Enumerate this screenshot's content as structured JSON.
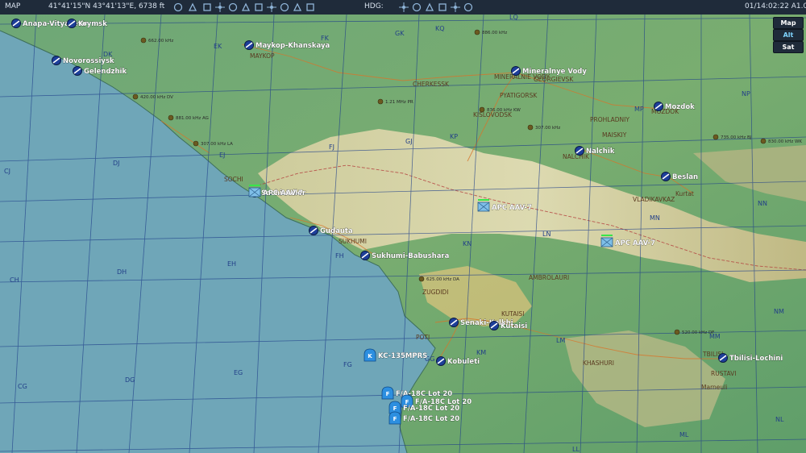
{
  "topbar": {
    "app_label": "MAP",
    "coords": "41°41'15\"N 43°41'13\"E, 6738 ft",
    "hdg_label": "HDG:",
    "clock": "01/14:02:22 A1.00",
    "icons": [
      "navigate-icon",
      "label-icon",
      "circle-icon",
      "grid-icon",
      "eye-icon",
      "dots-icon",
      "target-icon",
      "radio-icon",
      "tower-icon",
      "compass-icon",
      "move-icon",
      "zoom-in-icon",
      "zoom-out-icon",
      "zoom-fit-icon",
      "zoom-area-icon",
      "copy-icon",
      "layers-icon"
    ]
  },
  "map_modes": [
    "Map",
    "Alt",
    "Sat"
  ],
  "active_mode": "Alt",
  "colors": {
    "sea": "#6fa6b8",
    "topbar": "#1f2b3a",
    "grid": "#1f3f8a",
    "airbase": "#1e3f9a",
    "friendly_aircraft": "#2d8fe0",
    "label": "#ffffff"
  },
  "grid_labels": [
    "LQ",
    "KQ",
    "GK",
    "FK",
    "EK",
    "DK",
    "KP",
    "GJ",
    "FJ",
    "EJ",
    "DJ",
    "CJ",
    "MP",
    "NP",
    "NN",
    "MN",
    "LN",
    "KN",
    "FH",
    "EH",
    "DH",
    "CH",
    "NM",
    "MM",
    "LM",
    "KM",
    "GG",
    "FG",
    "EG",
    "DG",
    "CG",
    "NL",
    "ML",
    "LL"
  ],
  "place_labels": [
    "CHERKESSK",
    "MINERALNIE VODY",
    "GEORGIEVSK",
    "PYATIGORSK",
    "KISLOVODSK",
    "PROHLADNIY",
    "MAISKIY",
    "NALCHIK",
    "MOZDOK",
    "VLADIKAVKAZ",
    "Kurtat",
    "SOCHI",
    "SUKHUMI",
    "AMBROLAURI",
    "ZUGDIDI",
    "KUTAISI",
    "POTI",
    "KHASHURI",
    "TBILISI",
    "RUSTAVI",
    "Marneuli",
    "MAYKOP"
  ],
  "airbases": [
    {
      "name": "Anapa-Vityazevo"
    },
    {
      "name": "Krymsk"
    },
    {
      "name": "Novorossiysk"
    },
    {
      "name": "Gelendzhik"
    },
    {
      "name": "Maykop-Khanskaya"
    },
    {
      "name": "Mineralnye Vody"
    },
    {
      "name": "Mozdok"
    },
    {
      "name": "Nalchik"
    },
    {
      "name": "Beslan"
    },
    {
      "name": "Sochi-Adler"
    },
    {
      "name": "Gudauta"
    },
    {
      "name": "Sukhumi-Babushara"
    },
    {
      "name": "Senaki-Kolkhi"
    },
    {
      "name": "Kutaisi"
    },
    {
      "name": "Kobuleti"
    },
    {
      "name": "Tbilisi-Lochini"
    }
  ],
  "radio_beacons": [
    "662.00 kHz",
    "420.00 kHz DV",
    "881.00 kHz AG",
    "307.00 kHz LA",
    "886.00 kHz",
    "1.21 MHz PR",
    "836.00 kHz KW",
    "307.00 kHz",
    "735.00 kHz BJ",
    "830.00 kHz WK",
    "625.00 kHz DA",
    "520.00 kHz DF"
  ],
  "units": [
    {
      "callsign": "APC AAV-7",
      "type": "ground"
    },
    {
      "callsign": "APC AAV-7",
      "type": "ground"
    },
    {
      "callsign": "APC AAV-7",
      "type": "ground"
    },
    {
      "callsign": "KC-135MPRS",
      "type": "tanker",
      "symbol": "K"
    },
    {
      "callsign": "F/A-18C Lot 20",
      "type": "fighter",
      "symbol": "F"
    },
    {
      "callsign": "F/A-18C Lot 20",
      "type": "fighter",
      "symbol": "F"
    },
    {
      "callsign": "F/A-18C Lot 20",
      "type": "fighter",
      "symbol": "F"
    },
    {
      "callsign": "F/A-18C Lot 20",
      "type": "fighter",
      "symbol": "F"
    }
  ]
}
